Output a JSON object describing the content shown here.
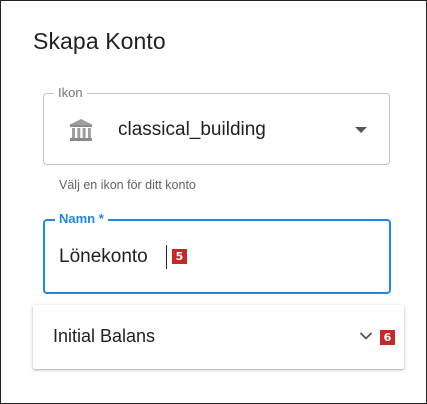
{
  "dialog": {
    "title": "Skapa Konto"
  },
  "icon_field": {
    "label": "Ikon",
    "value": "classical_building",
    "icon": "classical-building-icon",
    "helper_text": "Välj en ikon för ditt konto"
  },
  "name_field": {
    "label": "Namn *",
    "value": "Lönekonto",
    "focused": true,
    "accent_color": "#1e88e5"
  },
  "initial_balance_panel": {
    "title": "Initial Balans",
    "expanded": false,
    "icon": "chevron-down-icon"
  },
  "annotations": {
    "name_input_badge": "5",
    "panel_toggle_badge": "6",
    "badge_color": "#c62828"
  }
}
